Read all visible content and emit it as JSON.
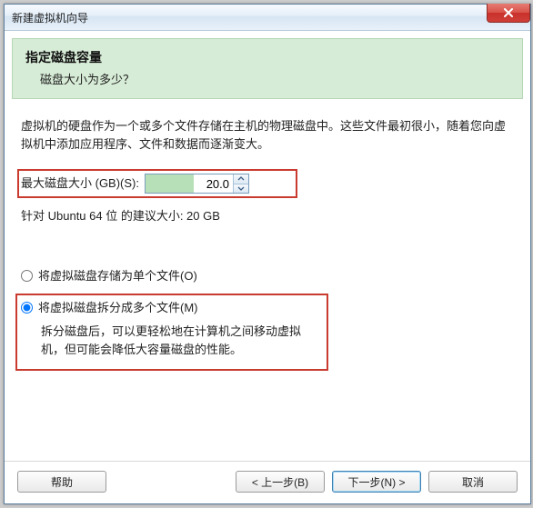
{
  "window": {
    "title": "新建虚拟机向导"
  },
  "header": {
    "title": "指定磁盘容量",
    "subtitle": "磁盘大小为多少？"
  },
  "description": "虚拟机的硬盘作为一个或多个文件存储在主机的物理磁盘中。这些文件最初很小，随着您向虚拟机中添加应用程序、文件和数据而逐渐变大。",
  "disk": {
    "label": "最大磁盘大小 (GB)(S):",
    "value": "20.0",
    "recommendation": "针对 Ubuntu 64 位 的建议大小: 20 GB"
  },
  "options": {
    "single": "将虚拟磁盘存储为单个文件(O)",
    "split": "将虚拟磁盘拆分成多个文件(M)",
    "split_desc": "拆分磁盘后，可以更轻松地在计算机之间移动虚拟机，但可能会降低大容量磁盘的性能。",
    "selected": "split"
  },
  "buttons": {
    "help": "帮助",
    "back": "< 上一步(B)",
    "next": "下一步(N) >",
    "cancel": "取消"
  }
}
